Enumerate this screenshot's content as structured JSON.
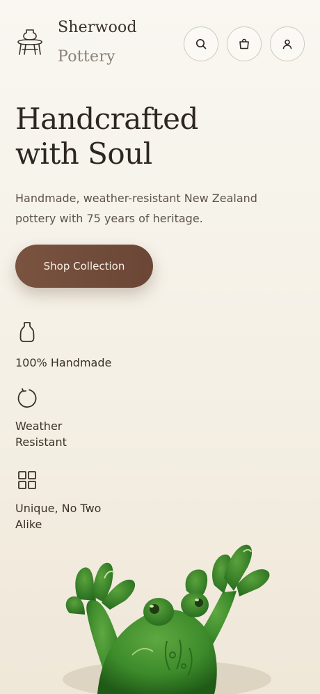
{
  "brand": {
    "line1": "Sherwood",
    "line2": "Pottery"
  },
  "header": {
    "icons": [
      "search-icon",
      "shopping-bag-icon",
      "user-icon"
    ]
  },
  "hero": {
    "title_line1": "Handcrafted",
    "title_line2": "with Soul",
    "subtitle": "Handmade, weather-resistant New Zealand pottery with 75 years of heritage.",
    "cta_label": "Shop Collection"
  },
  "features": [
    {
      "icon": "vase-icon",
      "label": "100% Handmade"
    },
    {
      "icon": "refresh-icon",
      "label": "Weather Resistant"
    },
    {
      "icon": "grid-icon",
      "label": "Unique, No Two Alike"
    }
  ],
  "colors": {
    "background": "#f6f2ea",
    "text": "#3a3129",
    "muted": "#8a8078",
    "cta": "#74503d",
    "frog_green": "#3f8a2a"
  }
}
